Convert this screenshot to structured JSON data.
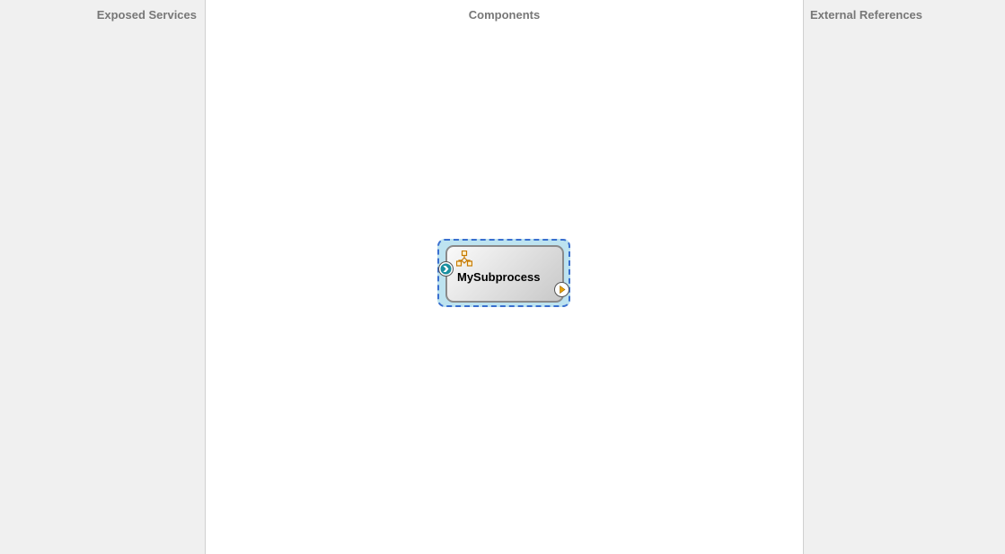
{
  "panels": {
    "left": "Exposed Services",
    "middle": "Components",
    "right": "External References"
  },
  "component": {
    "name": "MySubprocess",
    "icon": "subprocess-hierarchy-icon",
    "in_port": "service-port-icon",
    "out_port": "reference-port-icon"
  }
}
